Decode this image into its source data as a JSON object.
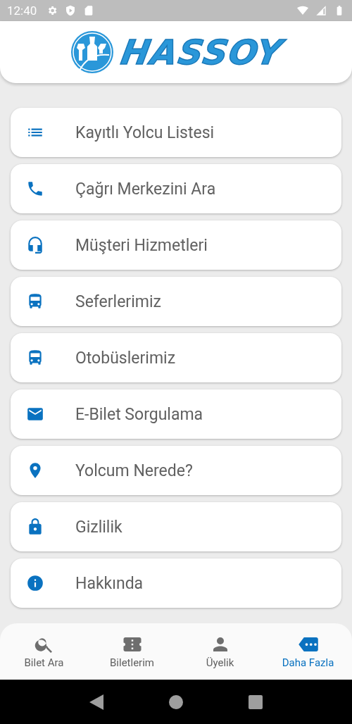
{
  "status_bar": {
    "time": "12:40"
  },
  "header": {
    "logo_text": "HASSOY"
  },
  "menu": [
    {
      "label": "Kayıtlı Yolcu Listesi"
    },
    {
      "label": "Çağrı Merkezini Ara"
    },
    {
      "label": "Müşteri Hizmetleri"
    },
    {
      "label": "Seferlerimiz"
    },
    {
      "label": "Otobüslerimiz"
    },
    {
      "label": "E-Bilet Sorgulama"
    },
    {
      "label": "Yolcum Nerede?"
    },
    {
      "label": "Gizlilik"
    },
    {
      "label": "Hakkında"
    }
  ],
  "bottom_nav": [
    {
      "label": "Bilet Ara",
      "selected": false
    },
    {
      "label": "Biletlerim",
      "selected": false
    },
    {
      "label": "Üyelik",
      "selected": false
    },
    {
      "label": "Daha Fazla",
      "selected": true
    }
  ]
}
